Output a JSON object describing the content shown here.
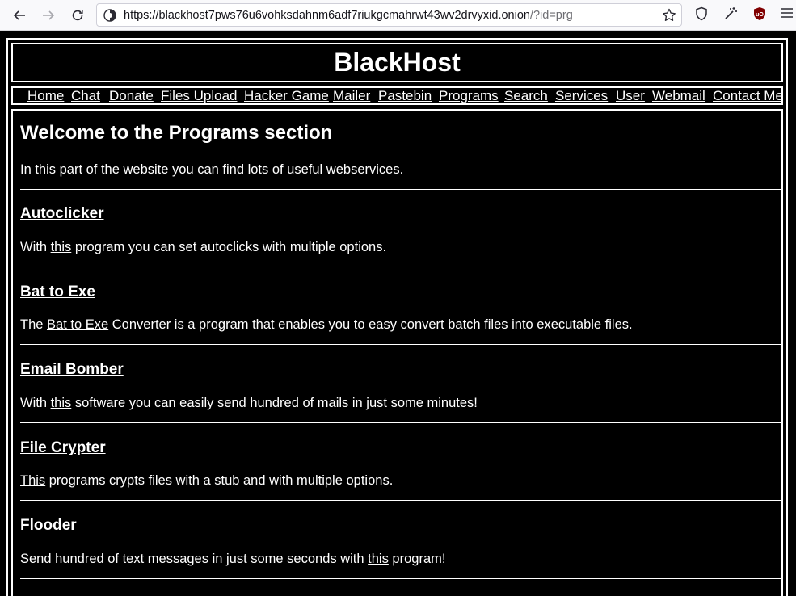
{
  "browser": {
    "url_host": "https://blackhost7pws76u6vohksdahnm6adf7riukgcmahrwt43wv2drvyxid.onion",
    "url_path": "/?id=prg"
  },
  "site": {
    "title": "BlackHost",
    "nav": [
      "Home",
      "Chat",
      "Donate",
      "Files Upload",
      "Hacker Game",
      "Mailer",
      "Pastebin",
      "Programs",
      "Search",
      "Services",
      "User",
      "Webmail",
      "Contact Me"
    ]
  },
  "main": {
    "heading": "Welcome to the Programs section",
    "intro": "In this part of the website you can find lots of useful webservices.",
    "programs": [
      {
        "title": "Autoclicker",
        "pre": "With ",
        "link": "this",
        "post": " program you can set autoclicks with multiple options."
      },
      {
        "title": "Bat to Exe",
        "pre": "The ",
        "link": "Bat to Exe",
        "post": " Converter is a program that enables you to easy convert batch files into executable files."
      },
      {
        "title": "Email Bomber",
        "pre": "With ",
        "link": "this",
        "post": " software you can easily send hundred of mails in just some minutes!"
      },
      {
        "title": "File Crypter",
        "pre": "",
        "link": "This",
        "post": " programs crypts files with a stub and with multiple options."
      },
      {
        "title": "Flooder",
        "pre": "Send hundred of text messages in just some seconds with ",
        "link": "this",
        "post": " program!"
      }
    ]
  }
}
